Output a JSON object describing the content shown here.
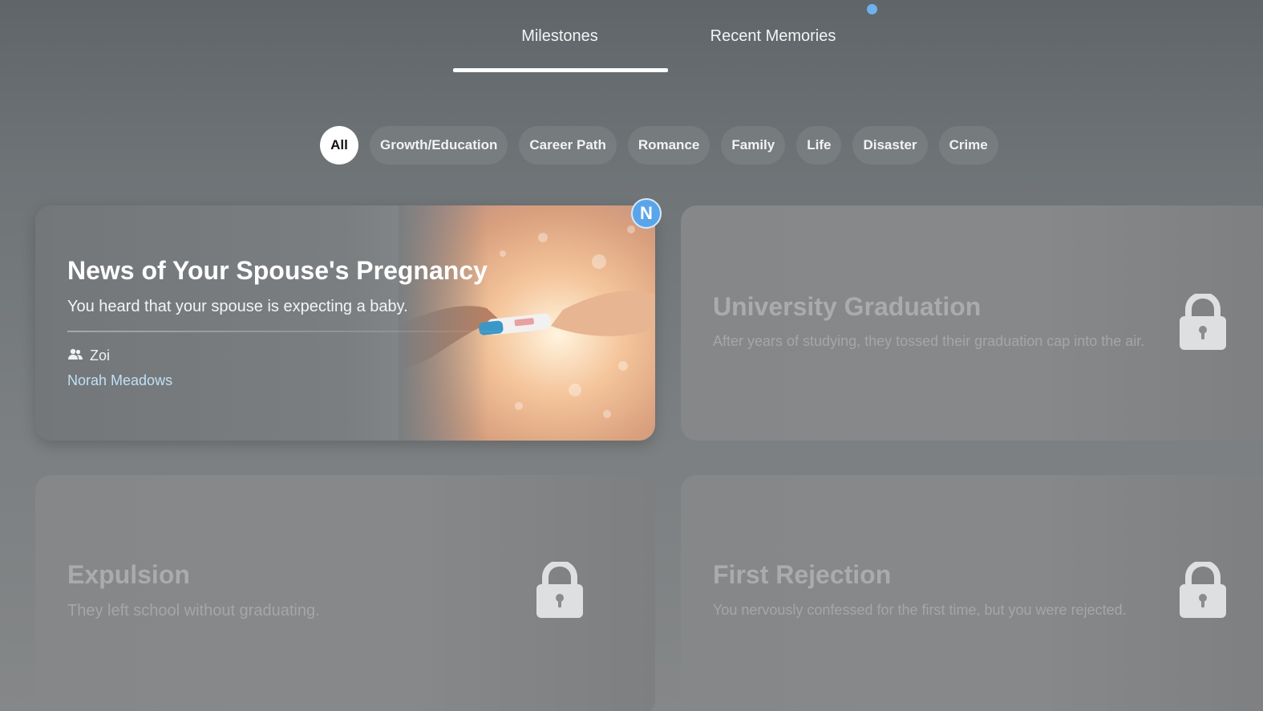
{
  "tabs": {
    "milestones": "Milestones",
    "recent": "Recent Memories"
  },
  "filters": [
    "All",
    "Growth/Education",
    "Career Path",
    "Romance",
    "Family",
    "Life",
    "Disaster",
    "Crime"
  ],
  "cards": {
    "main": {
      "title": "News of Your Spouse's Pregnancy",
      "desc": "You heard that your spouse is expecting a baby.",
      "person": "Zoi",
      "link": "Norah Meadows",
      "badge": "N"
    },
    "c2": {
      "title": "University Graduation",
      "desc": "After years of studying, they tossed their graduation cap into the air."
    },
    "c3": {
      "title": "Expulsion",
      "desc": "They left school without graduating."
    },
    "c4": {
      "title": "First Rejection",
      "desc": "You nervously confessed for the first time, but you were rejected."
    }
  },
  "icons": {
    "people": "people-icon",
    "lock": "lock-icon"
  },
  "colors": {
    "accent_badge": "#5aa5ea",
    "link": "#bfe0f6",
    "notification_dot": "#6fb0ee"
  }
}
